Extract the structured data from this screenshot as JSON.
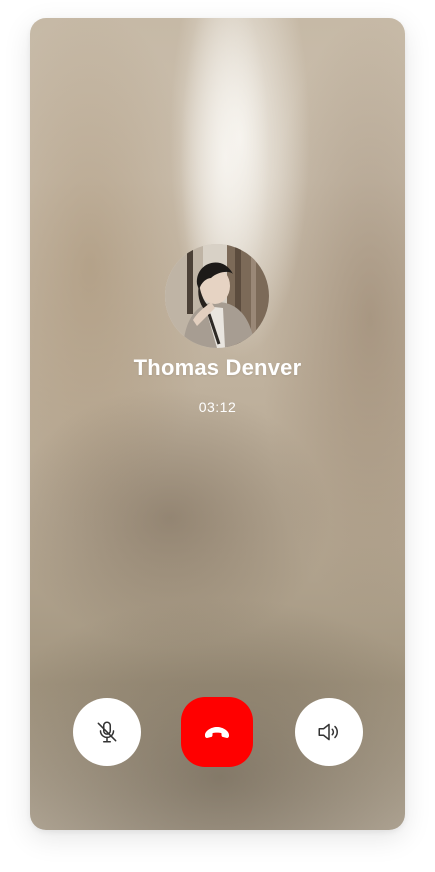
{
  "call": {
    "caller_name": "Thomas Denver",
    "duration": "03:12"
  },
  "controls": {
    "mute": {
      "icon": "microphone-off-icon"
    },
    "end_call": {
      "icon": "phone-hangup-icon",
      "color": "#ff0000"
    },
    "speaker": {
      "icon": "speaker-icon"
    }
  },
  "colors": {
    "control_background": "#ffffff",
    "end_call": "#ff0000",
    "text": "#ffffff"
  }
}
